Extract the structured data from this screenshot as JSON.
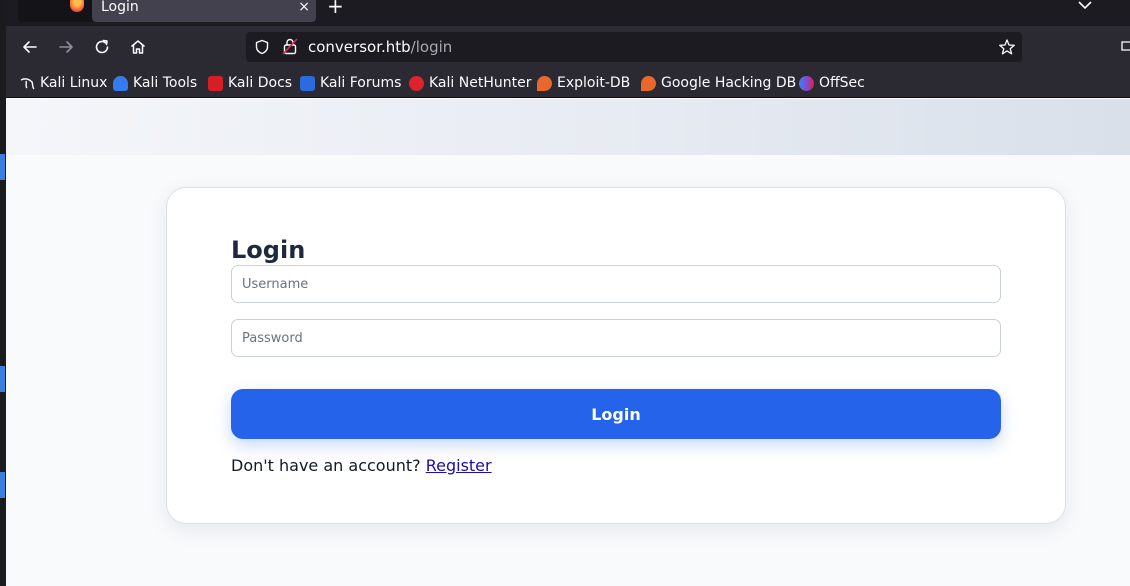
{
  "browser": {
    "tab": {
      "title": "Login",
      "close_glyph": "×"
    },
    "new_tab_glyph": "+",
    "url": {
      "host": "conversor.htb",
      "path": "/login"
    },
    "bookmarks": [
      {
        "label": "Kali Linux",
        "icon": "kali-dragon-icon",
        "color": "#2b2a33"
      },
      {
        "label": "Kali Tools",
        "icon": "kali-tools-icon",
        "color": "#367bf0"
      },
      {
        "label": "Kali Docs",
        "icon": "kali-docs-icon",
        "color": "#d61f25"
      },
      {
        "label": "Kali Forums",
        "icon": "kali-forums-icon",
        "color": "#2a6be0"
      },
      {
        "label": "Kali NetHunter",
        "icon": "kali-nethunter-icon",
        "color": "#e0222c"
      },
      {
        "label": "Exploit-DB",
        "icon": "exploit-db-icon",
        "color": "#e8672b"
      },
      {
        "label": "Google Hacking DB",
        "icon": "ghdb-icon",
        "color": "#e8672b"
      },
      {
        "label": "OffSec",
        "icon": "offsec-icon",
        "color": "#7d4fd6"
      }
    ]
  },
  "page": {
    "title": "Login",
    "username": {
      "placeholder": "Username",
      "value": ""
    },
    "password": {
      "placeholder": "Password",
      "value": ""
    },
    "login_button": "Login",
    "register_prompt": "Don't have an account?",
    "register_link": "Register"
  },
  "colors": {
    "primary": "#2563eb",
    "link": "#1a0dab",
    "heading": "#1e293b"
  }
}
